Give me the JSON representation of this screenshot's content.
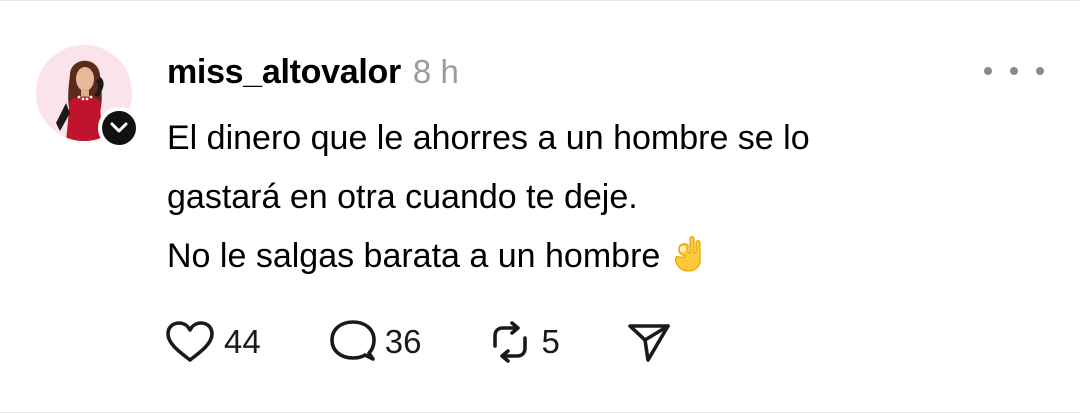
{
  "post": {
    "username": "miss_altovalor",
    "time": "8 h",
    "text_lines": [
      "El dinero que le ahorres a un hombre se lo",
      "gastará en otra cuando te deje.",
      "No le salgas barata a un hombre"
    ],
    "emoji": "ok-hand",
    "verified": true
  },
  "actions": {
    "likes": "44",
    "replies": "36",
    "reposts": "5"
  },
  "icons": {
    "like": "heart-icon",
    "reply": "speech-bubble-icon",
    "repost": "repost-icon",
    "share": "send-icon",
    "more": "more-dots-icon"
  },
  "colors": {
    "text": "#000000",
    "muted": "#9a9a9a",
    "avatar_bg": "#fbe3ea",
    "badge": "#111111"
  }
}
